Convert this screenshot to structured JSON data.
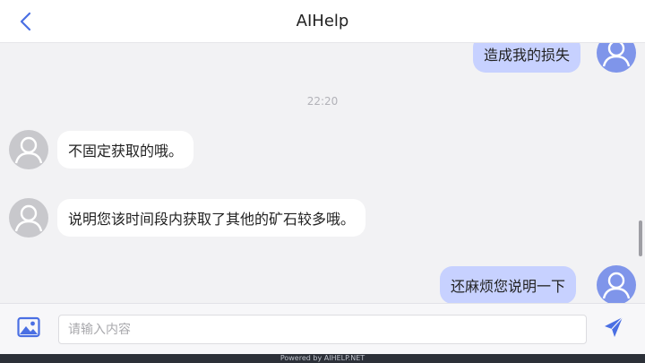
{
  "header": {
    "title": "AIHelp"
  },
  "messages": [
    {
      "sender": "user",
      "text": "造成我的损失"
    },
    {
      "sender": "agent",
      "text": "不固定获取的哦。"
    },
    {
      "sender": "agent",
      "text": "说明您该时间段内获取了其他的矿石较多哦。"
    },
    {
      "sender": "user",
      "text": "还麻烦您说明一下"
    }
  ],
  "timestamp": "22:20",
  "input": {
    "placeholder": "请输入内容",
    "value": ""
  },
  "footer": {
    "text": "Powered by AIHELP.NET"
  },
  "colors": {
    "accent": "#4a6fe3",
    "user_bubble": "#c7d1ff",
    "agent_bubble": "#ffffff",
    "user_avatar": "#7f95ea",
    "agent_avatar": "#c8c8cc"
  },
  "icons": [
    "back-icon",
    "user-avatar-icon",
    "agent-avatar-icon",
    "image-icon",
    "send-icon"
  ]
}
